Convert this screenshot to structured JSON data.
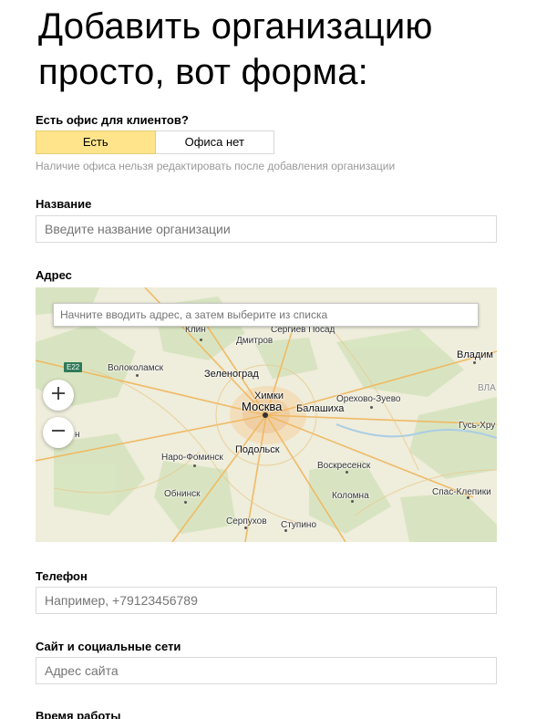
{
  "heading": {
    "line1": "Добавить организацию",
    "line2": "просто, вот форма:"
  },
  "office": {
    "label": "Есть офис для клиентов?",
    "options": [
      "Есть",
      "Офиса нет"
    ],
    "selected": "Есть",
    "hint": "Наличие офиса нельзя редактировать после добавления организации"
  },
  "name": {
    "label": "Название",
    "placeholder": "Введите название организации"
  },
  "address": {
    "label": "Адрес",
    "placeholder": "Начните вводить адрес, а затем выберите из списка",
    "road_badge": "E22",
    "cities": [
      "Клин",
      "Сергиев Посад",
      "Дмитров",
      "Владим",
      "Волоколамск",
      "Зеленоград",
      "Химки",
      "Москва",
      "Балашиха",
      "Орехово-Зуево",
      "ВЛА",
      "Гусь-Хру",
      "н",
      "Наро-Фоминск",
      "Подольск",
      "Воскресенск",
      "Обнинск",
      "Коломна",
      "Спас-Клепики",
      "Серпухов",
      "Ступино"
    ],
    "zoom_in": "+",
    "zoom_out": "−"
  },
  "phone": {
    "label": "Телефон",
    "placeholder": "Например, +79123456789"
  },
  "site": {
    "label": "Сайт и социальные сети",
    "placeholder": "Адрес сайта"
  },
  "hours": {
    "label": "Время работы"
  }
}
